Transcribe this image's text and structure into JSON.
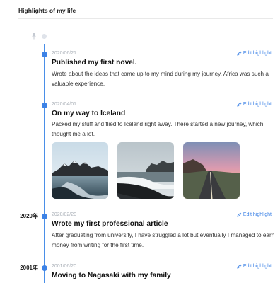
{
  "header": {
    "title": "Highlights of my life"
  },
  "icons": {
    "pin": "pin-icon",
    "edit": "pencil-icon"
  },
  "colors": {
    "accent": "#3c82e6",
    "line": "#4a8fe8"
  },
  "entries": [
    {
      "year": "",
      "date": "2020/06/21",
      "edit_label": "Edit highlight",
      "title": "Published my first novel.",
      "description": "Wrote about the ideas that came up to my mind during my journey. Africa was such a valuable experience."
    },
    {
      "year": "",
      "date": "2020/04/01",
      "edit_label": "Edit highlight",
      "title": "On my way to Iceland",
      "description": "Packed my stuff and flied to Iceland right away. There started a new journey, which thought me a lot.",
      "photos": [
        "mountain-lake-photo",
        "black-sand-beach-photo",
        "sunset-road-photo"
      ]
    },
    {
      "year": "2020年",
      "date": "2020/02/20",
      "edit_label": "Edit highlight",
      "title": "Wrote my first professional article",
      "description": "After graduating from university, I have struggled a lot but eventually I managed to earn money from writing for the first time."
    },
    {
      "year": "2001年",
      "date": "2001/06/20",
      "edit_label": "Edit highlight",
      "title": "Moving to Nagasaki with my family",
      "description": ""
    }
  ]
}
